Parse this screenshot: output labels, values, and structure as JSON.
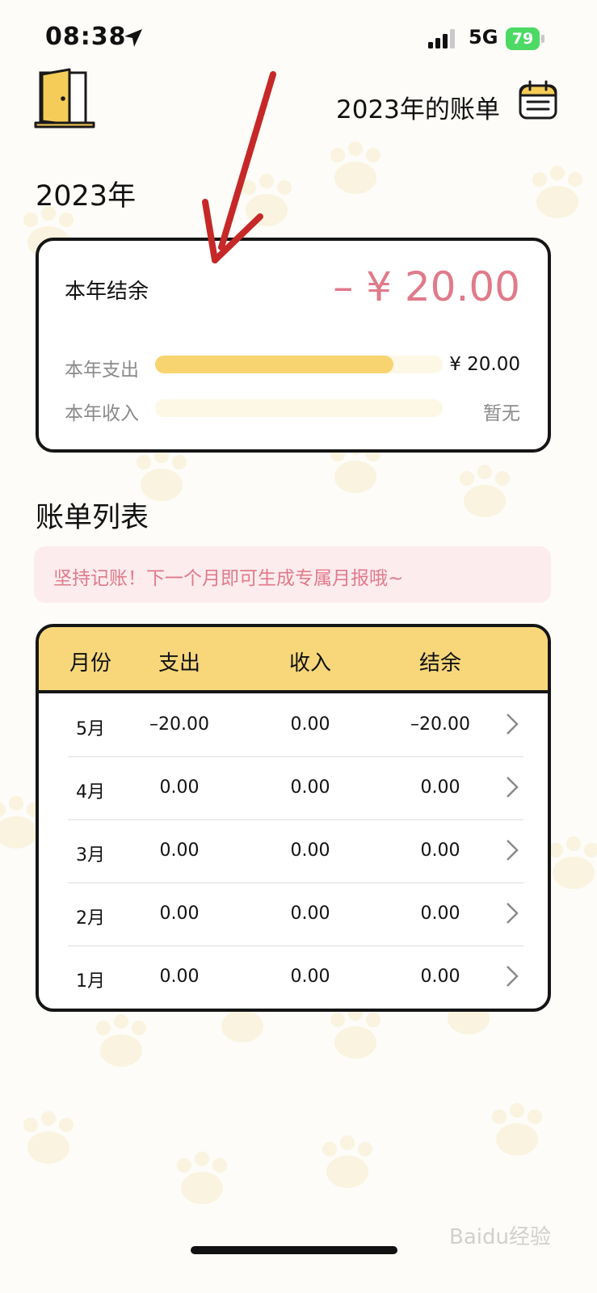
{
  "status_bar": {
    "time": "08:38",
    "network": "5G",
    "battery": "79"
  },
  "header": {
    "year_bill_link": "2023年的账单"
  },
  "year_title": "2023年",
  "summary": {
    "balance_label": "本年结余",
    "balance_value": "– ¥ 20.00",
    "expense_label": "本年支出",
    "expense_value": "¥ 20.00",
    "expense_bar_fraction": 0.83,
    "income_label": "本年收入",
    "income_value": "暂无",
    "income_bar_fraction": 0
  },
  "list_title": "账单列表",
  "tip": "坚持记账！下一个月即可生成专属月报哦~",
  "table": {
    "headers": [
      "月份",
      "支出",
      "收入",
      "结余"
    ],
    "rows": [
      {
        "month": "5月",
        "expense": "–20.00",
        "income": "0.00",
        "balance": "–20.00"
      },
      {
        "month": "4月",
        "expense": "0.00",
        "income": "0.00",
        "balance": "0.00"
      },
      {
        "month": "3月",
        "expense": "0.00",
        "income": "0.00",
        "balance": "0.00"
      },
      {
        "month": "2月",
        "expense": "0.00",
        "income": "0.00",
        "balance": "0.00"
      },
      {
        "month": "1月",
        "expense": "0.00",
        "income": "0.00",
        "balance": "0.00"
      }
    ]
  },
  "watermark": "Baidu经验",
  "colors": {
    "accent_yellow": "#f7d46f",
    "accent_pink": "#e07a8a",
    "tip_bg": "#fdecee",
    "battery": "#4cd964",
    "annotation_arrow": "#c62828"
  },
  "icons": [
    "location-icon",
    "signal-icon",
    "battery-icon",
    "door-icon",
    "calendar-icon",
    "chevron-right-icon"
  ]
}
